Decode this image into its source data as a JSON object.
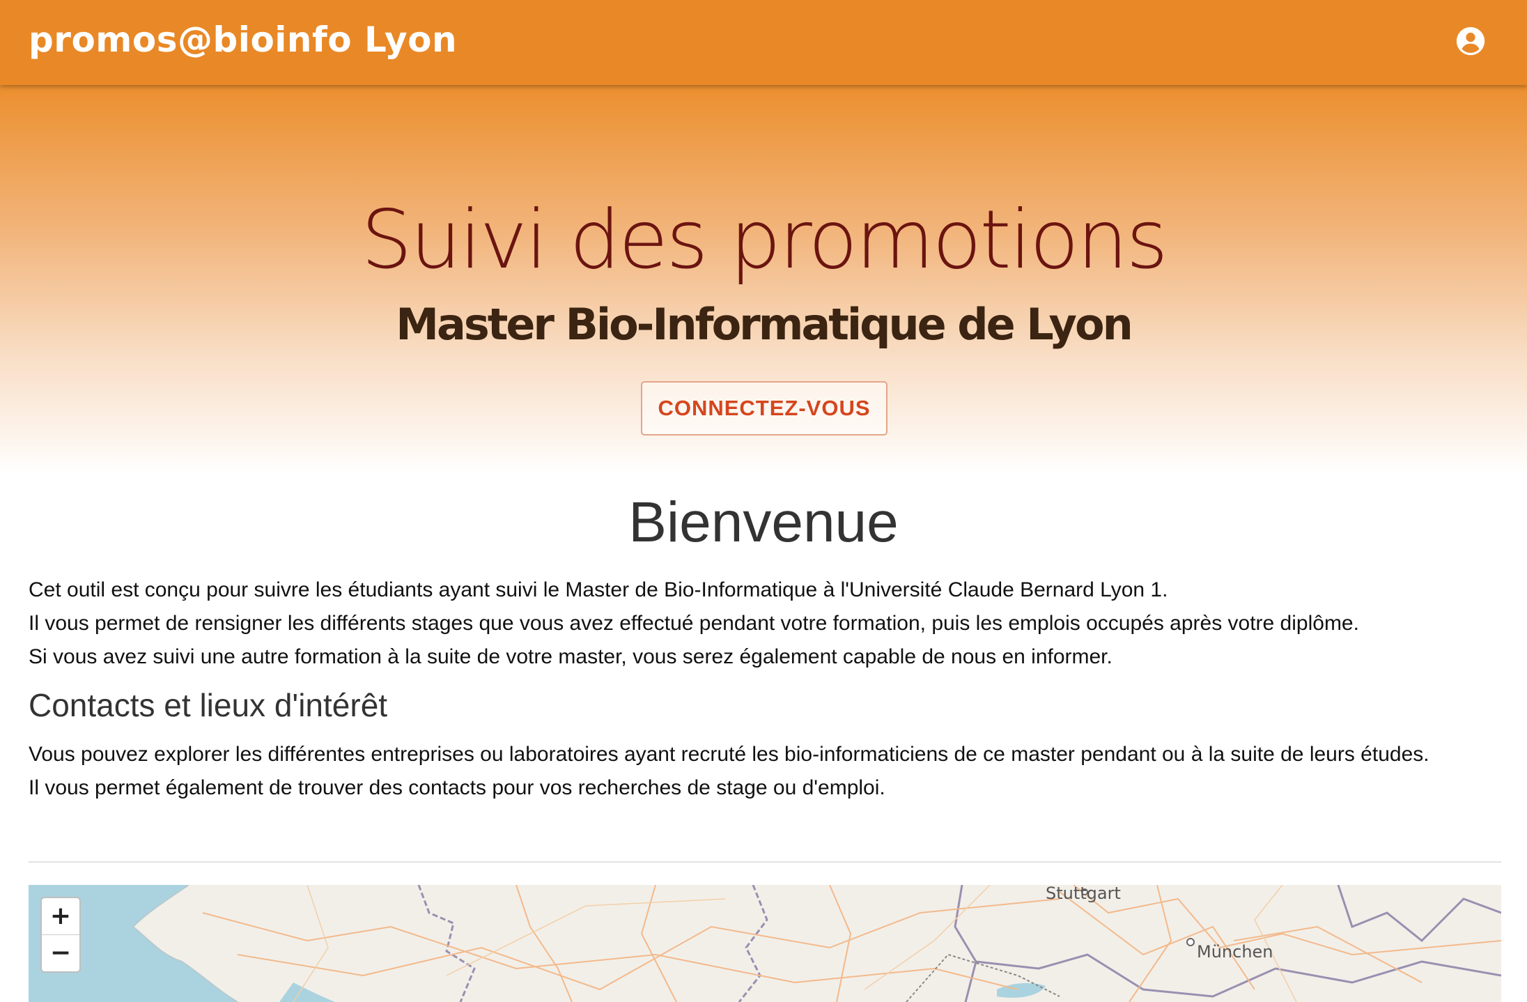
{
  "header": {
    "brand": "promos@bioinfo Lyon",
    "account_icon": "account-circle-icon"
  },
  "hero": {
    "title": "Suivi des promotions",
    "subtitle": "Master Bio-Informatique de Lyon",
    "button_label": "CONNECTEZ-VOUS"
  },
  "welcome": {
    "title": "Bienvenue",
    "lines": [
      "Cet outil est conçu pour suivre les étudiants ayant suivi le Master de Bio-Informatique à l'Université Claude Bernard Lyon 1.",
      "Il vous permet de rensigner les différents stages que vous avez effectué pendant votre formation, puis les emplois occupés après votre diplôme.",
      "Si vous avez suivi une autre formation à la suite de votre master, vous serez également capable de nous en informer."
    ]
  },
  "contacts": {
    "title": "Contacts et lieux d'intérêt",
    "lines": [
      "Vous pouvez explorer les différentes entreprises ou laboratoires ayant recruté les bio-informaticiens de ce master pendant ou à la suite de leurs études.",
      "Il vous permet également de trouver des contacts pour vos recherches de stage ou d'emploi."
    ]
  },
  "map": {
    "zoom_in": "+",
    "zoom_out": "−",
    "cities": [
      "Stuttgart",
      "München"
    ]
  }
}
